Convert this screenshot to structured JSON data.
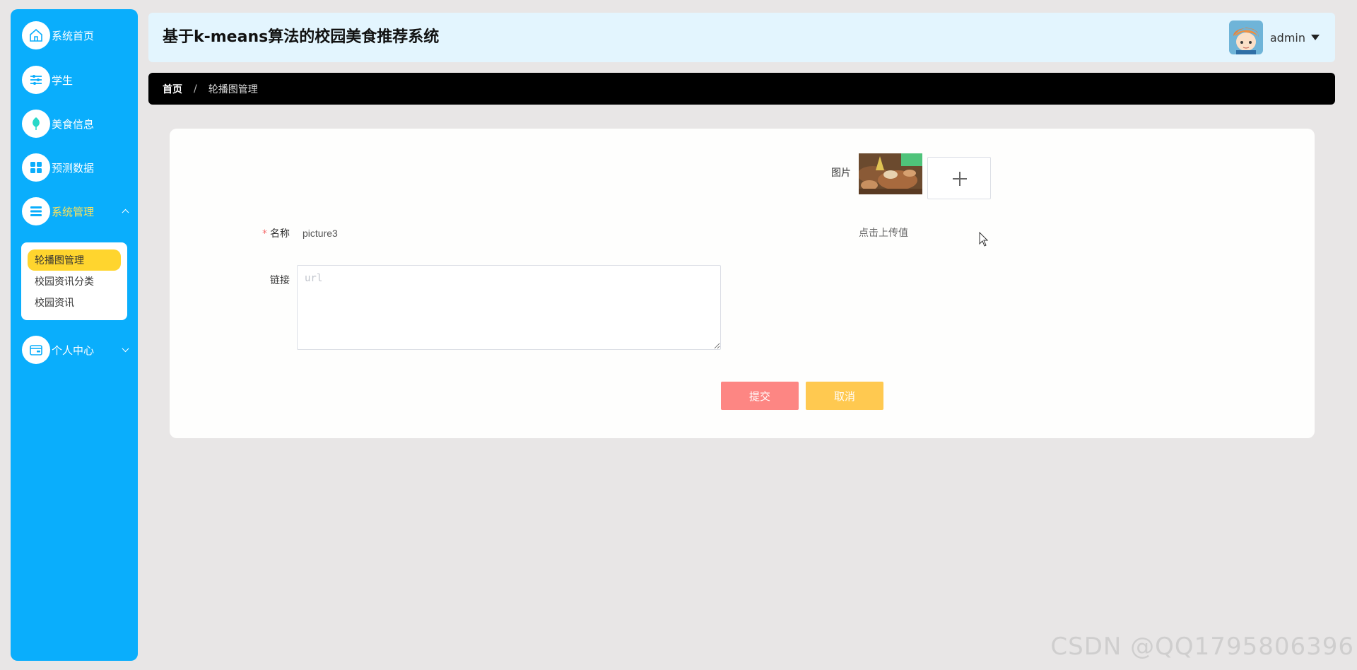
{
  "app": {
    "title": "基于k-means算法的校园美食推荐系统"
  },
  "sidebar": {
    "items": [
      {
        "label": "系统首页",
        "icon": "home-icon"
      },
      {
        "label": "学生",
        "icon": "sliders-icon"
      },
      {
        "label": "美食信息",
        "icon": "leaf-icon"
      },
      {
        "label": "预测数据",
        "icon": "grid-icon"
      },
      {
        "label": "系统管理",
        "icon": "list-icon",
        "expanded": true
      },
      {
        "label": "个人中心",
        "icon": "wallet-icon",
        "expanded": false
      }
    ],
    "submenu": [
      {
        "label": "轮播图管理",
        "active": true
      },
      {
        "label": "校园资讯分类"
      },
      {
        "label": "校园资讯"
      }
    ]
  },
  "header": {
    "username": "admin"
  },
  "breadcrumb": {
    "home": "首页",
    "separator": "/",
    "current": "轮播图管理"
  },
  "form": {
    "image_label": "图片",
    "upload_tip": "点击上传值",
    "name_label": "名称",
    "name_required": "*",
    "name_value": "picture3",
    "link_label": "链接",
    "link_placeholder": "url",
    "submit_label": "提交",
    "cancel_label": "取消"
  },
  "watermark": "CSDN @QQ1795806396",
  "colors": {
    "sidebar": "#0aaefc",
    "header": "#e3f5fe",
    "active_sub": "#ffd52e",
    "submit": "#fd8683",
    "cancel": "#ffc950"
  }
}
